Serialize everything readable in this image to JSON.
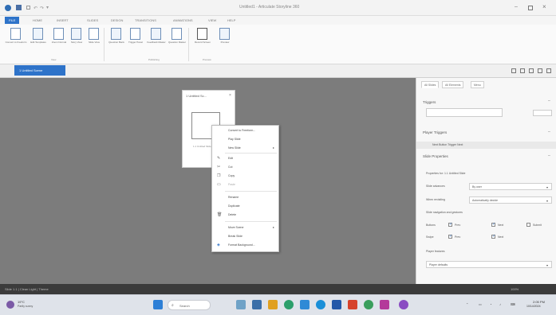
{
  "colors": {
    "accent": "#2e73c9",
    "stage": "#7c7c7c",
    "statusbar": "#3b3b3b",
    "taskbar": "#dfe3ea"
  },
  "titlebar": {
    "title": "Untitled1 - Articulate Storyline 360",
    "logo_icon": "storyline-logo-icon"
  },
  "tabs": [
    "FILE",
    "HOME",
    "INSERT",
    "SLIDES",
    "DESIGN",
    "TRANSITIONS",
    "ANIMATIONS",
    "VIEW",
    "HELP"
  ],
  "active_tab": "SLIDES",
  "ribbon": {
    "buttons": [
      {
        "label": "Convert to Freeform",
        "icon": "convert-icon"
      },
      {
        "label": "Edit Templates",
        "icon": "templates-icon"
      },
      {
        "label": "Zoom Normal",
        "icon": "zoom-icon"
      },
      {
        "label": "Story View",
        "icon": "story-icon"
      },
      {
        "label": "Slide View",
        "icon": "slide-icon"
      },
      {
        "label": "Question Bank",
        "icon": "bank-icon"
      },
      {
        "label": "Trigger Panel",
        "icon": "trigger-icon"
      },
      {
        "label": "Feedback Master",
        "icon": "feedback-icon"
      },
      {
        "label": "Question Master",
        "icon": "master-icon"
      },
      {
        "label": "Record Screen",
        "icon": "record-icon"
      },
      {
        "label": "Preview",
        "icon": "preview-icon"
      }
    ],
    "groups": [
      "View",
      "Publishing",
      "Preview"
    ]
  },
  "slide_strip": {
    "tab_label": "1 Untitled Scene"
  },
  "stage": {
    "card_title": "1 Untitled Sc...",
    "thumb_label": "1.1 Untitled Slide"
  },
  "context_menu": {
    "items": [
      {
        "label": "Convert to Freeform...",
        "icon": "",
        "submenu": false,
        "disabled": false
      },
      {
        "label": "Play Slide",
        "icon": "",
        "submenu": false,
        "disabled": false
      },
      {
        "label": "New Slide",
        "icon": "",
        "submenu": true,
        "disabled": false
      },
      {
        "label": "Edit",
        "icon": "edit-icon",
        "submenu": false,
        "disabled": false
      },
      {
        "label": "Cut",
        "icon": "cut-icon",
        "submenu": false,
        "disabled": false
      },
      {
        "label": "Copy",
        "icon": "copy-icon",
        "submenu": false,
        "disabled": false
      },
      {
        "label": "Paste",
        "icon": "paste-icon",
        "submenu": false,
        "disabled": true
      },
      {
        "label": "Rename",
        "icon": "",
        "submenu": false,
        "disabled": false
      },
      {
        "label": "Duplicate",
        "icon": "",
        "submenu": false,
        "disabled": false
      },
      {
        "label": "Delete",
        "icon": "delete-icon",
        "submenu": false,
        "disabled": false
      },
      {
        "label": "Move Scene",
        "icon": "",
        "submenu": true,
        "disabled": false
      },
      {
        "label": "Break Slide",
        "icon": "",
        "submenu": false,
        "disabled": false
      },
      {
        "label": "Format Background...",
        "icon": "format-icon",
        "submenu": false,
        "disabled": false
      }
    ]
  },
  "panel": {
    "tabs": [
      "All Slides",
      "All Elements",
      "Menu"
    ],
    "triggers_title": "Triggers",
    "player_triggers": "Player Triggers",
    "player_trigger_item": "Next Button Trigger Next",
    "slide_properties": "Slide Properties",
    "properties_for": "Properties for: 1.1 Untitled Slide",
    "slide_advances_label": "Slide advances",
    "slide_advances_value": "By user",
    "when_revisiting_label": "When revisiting",
    "when_revisiting_value": "Automatically decide",
    "slide_nav_title": "Slide navigation and gestures",
    "buttons_label": "Buttons",
    "prev_label": "Prev",
    "next_label": "Next",
    "submit_label": "Submit",
    "swipe_label": "Swipe",
    "player_features_title": "Player features",
    "player_features_value": "Player defaults"
  },
  "statusbar": {
    "left": "Slide 1.1 | Clean Light | Theme",
    "right": "100%"
  },
  "taskbar": {
    "weather_temp": "19°C",
    "weather_desc": "Partly sunny",
    "search": "Search",
    "time": "2:05 PM",
    "date": "10/14/2024"
  }
}
